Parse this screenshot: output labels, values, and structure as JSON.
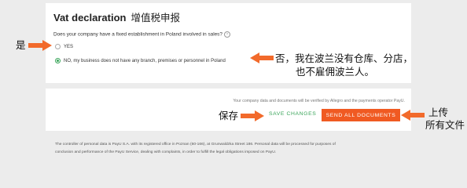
{
  "vat": {
    "title_en": "Vat declaration",
    "title_cn": "增值税申报",
    "question": "Does your company have a fixed establishment in Poland involved in sales?",
    "help_glyph": "?",
    "options": [
      {
        "label": "YES",
        "selected": false
      },
      {
        "label": "NO, my business does not have any branch, premises or personnel in Poland",
        "selected": true
      }
    ]
  },
  "annotations": {
    "yes": "是",
    "no_line1": "否，我在波兰没有仓库、分店，",
    "no_line2": "也不雇佣波兰人。",
    "save": "保存",
    "upload_line1": "上传",
    "upload_line2": "所有文件",
    "arrow_color": "#f26a2b"
  },
  "docs": {
    "info": "Your company data and documents will be verified by Allegro and the payments operator PayU.",
    "save_label": "SAVE CHANGES",
    "send_label": "SEND ALL DOCUMENTS"
  },
  "footer": {
    "line1": "The controller of personal data is PayU S.A. with its registered office in Poznan (60-166), at Grunwaldzka Street 186. Personal data will be processed for purposes of",
    "line2": "conclusion and performance of the PayU Service, dealing with complaints, in order to fulfill the legal obligations imposed on PayU."
  },
  "colors": {
    "accent_green": "#3aa55a",
    "accent_orange": "#f05a22"
  }
}
